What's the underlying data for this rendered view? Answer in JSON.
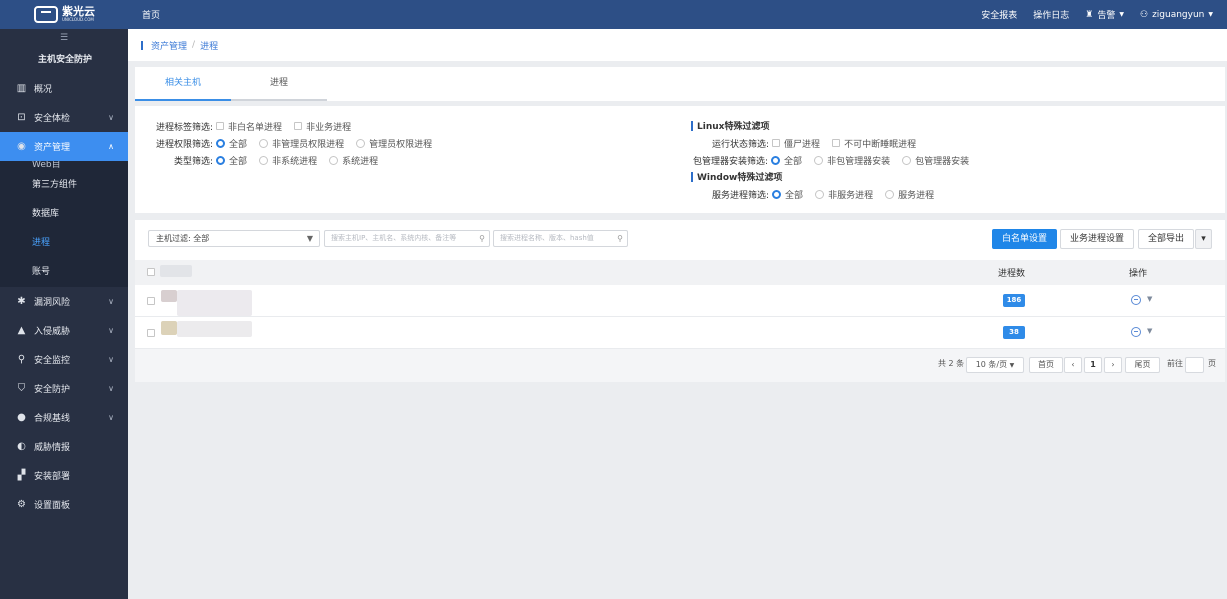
{
  "topbar": {
    "brand": "紫光云",
    "brand_sub": "UNICLOUD.COM",
    "home": "首页",
    "security_report": "安全报表",
    "operation_log": "操作日志",
    "alarm": "告警",
    "username": "ziguangyun"
  },
  "sidebar": {
    "title": "主机安全防护",
    "items": [
      {
        "label": "概况"
      },
      {
        "label": "安全体检"
      },
      {
        "label": "资产管理"
      },
      {
        "label": "漏洞风险"
      },
      {
        "label": "入侵威胁"
      },
      {
        "label": "安全监控"
      },
      {
        "label": "安全防护"
      },
      {
        "label": "合规基线"
      },
      {
        "label": "威胁情报"
      },
      {
        "label": "安装部署"
      },
      {
        "label": "设置面板"
      }
    ],
    "partial_sub": "Web目",
    "subitems": [
      {
        "label": "第三方组件"
      },
      {
        "label": "数据库"
      },
      {
        "label": "进程"
      },
      {
        "label": "账号"
      }
    ]
  },
  "breadcrumb": {
    "parent": "资产管理",
    "sep": "/",
    "current": "进程"
  },
  "tabs": [
    {
      "label": "相关主机"
    },
    {
      "label": "进程"
    }
  ],
  "filters": {
    "tag": {
      "label": "进程标签筛选:",
      "options": [
        "非白名单进程",
        "非业务进程"
      ]
    },
    "perm": {
      "label": "进程权限筛选:",
      "options": [
        "全部",
        "非管理员权限进程",
        "管理员权限进程"
      ]
    },
    "type": {
      "label": "类型筛选:",
      "options": [
        "全部",
        "非系统进程",
        "系统进程"
      ]
    },
    "linux_title": "Linux特殊过滤项",
    "run_state": {
      "label": "运行状态筛选:",
      "options": [
        "僵尸进程",
        "不可中断睡眠进程"
      ]
    },
    "pkg": {
      "label": "包管理器安装筛选:",
      "options": [
        "全部",
        "非包管理器安装",
        "包管理器安装"
      ]
    },
    "window_title": "Window特殊过滤项",
    "service": {
      "label": "服务进程筛选:",
      "options": [
        "全部",
        "非服务进程",
        "服务进程"
      ]
    }
  },
  "toolbar": {
    "host_filter": "主机过滤: 全部",
    "search_host_placeholder": "搜索主机IP、主机名、系统内核、备注等",
    "search_proc_placeholder": "搜索进程名称、版本、hash值",
    "whitelist_btn": "白名单设置",
    "business_btn": "业务进程设置",
    "export_btn": "全部导出"
  },
  "table": {
    "col_count": "进程数",
    "col_action": "操作",
    "rows": [
      {
        "count": "186"
      },
      {
        "count": "38"
      }
    ]
  },
  "pager": {
    "total": "共 2 条",
    "page_size": "10 条/页",
    "first": "首页",
    "prev": "‹",
    "page": "1",
    "next": "›",
    "last": "尾页",
    "goto": "前往",
    "page_unit": "页"
  }
}
